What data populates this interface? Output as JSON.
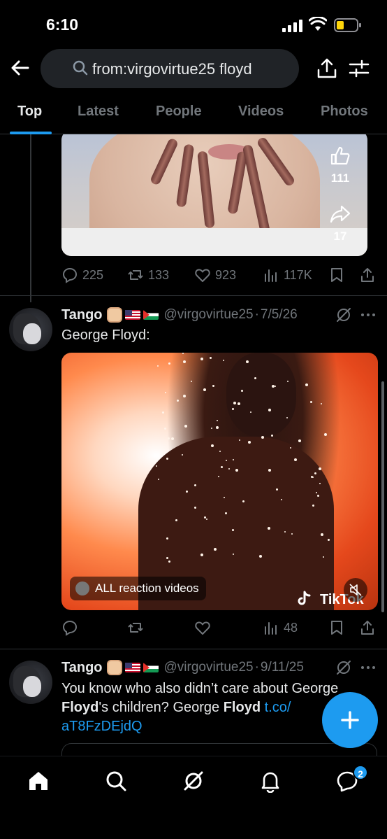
{
  "status_bar": {
    "time": "6:10"
  },
  "search": {
    "query": "from:virgovirtue25 floyd"
  },
  "tabs": [
    {
      "label": "Top",
      "active": true
    },
    {
      "label": "Latest",
      "active": false
    },
    {
      "label": "People",
      "active": false
    },
    {
      "label": "Videos",
      "active": false
    },
    {
      "label": "Photos",
      "active": false
    }
  ],
  "previous_tweet": {
    "video_side_counts": {
      "likes": "111",
      "shares": "17"
    },
    "actions": {
      "replies": "225",
      "reposts": "133",
      "likes": "923",
      "views": "117K"
    }
  },
  "tweets": [
    {
      "author": "Tango",
      "handle": "@virgovirtue25",
      "date": "7/5/26",
      "text": "George Floyd:",
      "media_chip": "ALL reaction videos",
      "watermark": "TikTok",
      "actions": {
        "replies": "",
        "reposts": "",
        "likes": "",
        "views": "48"
      }
    },
    {
      "author": "Tango",
      "handle": "@virgovirtue25",
      "date": "9/11/25",
      "text_parts": {
        "p1": "You know who also didn’t care about George ",
        "b1": "Floyd",
        "p2": "'s children? George ",
        "b2": "Floyd",
        "p3": " ",
        "link": "t.co/ aT8FzDEjdQ"
      }
    }
  ],
  "bottom_nav": {
    "items": [
      "home-icon",
      "search-icon",
      "grok-icon",
      "notifications-icon",
      "messages-icon"
    ],
    "messages_badge": "2"
  },
  "colors": {
    "accent": "#1d9bf0",
    "background": "#000000",
    "muted": "#71767b"
  }
}
